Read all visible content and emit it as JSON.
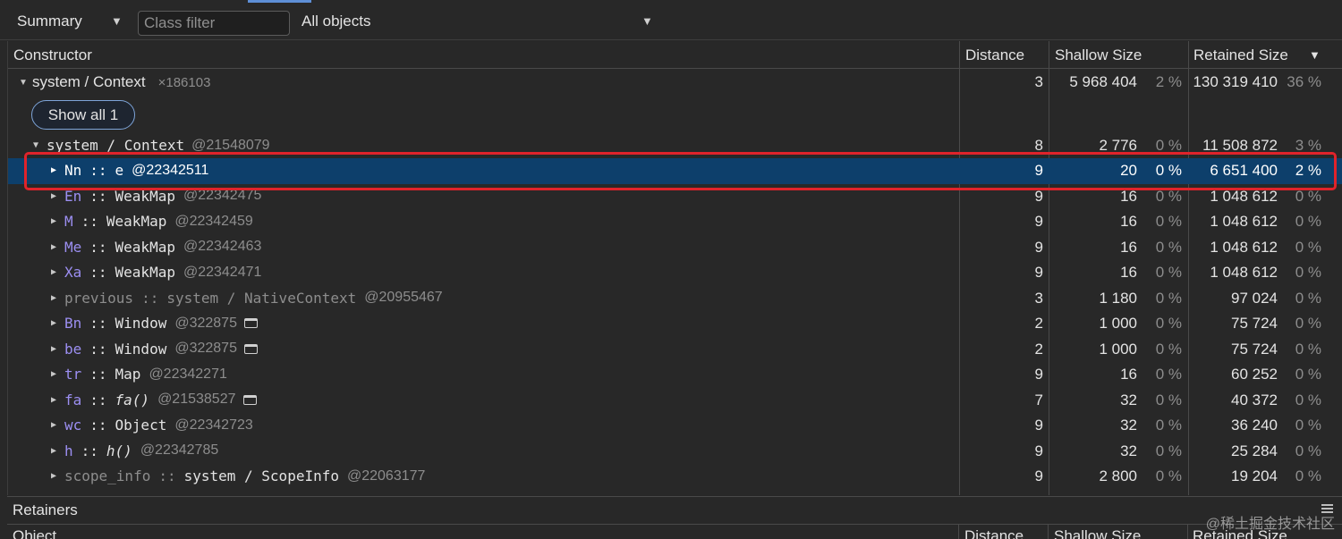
{
  "toolbar": {
    "view_select": "Summary",
    "class_filter_placeholder": "Class filter",
    "objects_select": "All objects"
  },
  "columns": {
    "constructor": "Constructor",
    "distance": "Distance",
    "shallow_size": "Shallow Size",
    "retained_size": "Retained Size"
  },
  "root": {
    "name": "system / Context",
    "count": "×186103",
    "distance": "3",
    "shallow": "5 968 404",
    "shallow_pct": "2 %",
    "retained": "130 319 410",
    "retained_pct": "36 %",
    "show_all_label": "Show all 1"
  },
  "context": {
    "name": "system / Context",
    "id": "@21548079",
    "distance": "8",
    "shallow": "2 776",
    "shallow_pct": "0 %",
    "retained": "11 508 872",
    "retained_pct": "3 %"
  },
  "rows": [
    {
      "prop": "Nn",
      "sep": "::",
      "cls": "e",
      "id": "@22342511",
      "distance": "9",
      "shallow": "20",
      "shallow_pct": "0 %",
      "retained": "6 651 400",
      "retained_pct": "2 %"
    },
    {
      "prop": "En",
      "sep": "::",
      "cls": "WeakMap",
      "id": "@22342475",
      "distance": "9",
      "shallow": "16",
      "shallow_pct": "0 %",
      "retained": "1 048 612",
      "retained_pct": "0 %"
    },
    {
      "prop": "M",
      "sep": "::",
      "cls": "WeakMap",
      "id": "@22342459",
      "distance": "9",
      "shallow": "16",
      "shallow_pct": "0 %",
      "retained": "1 048 612",
      "retained_pct": "0 %"
    },
    {
      "prop": "Me",
      "sep": "::",
      "cls": "WeakMap",
      "id": "@22342463",
      "distance": "9",
      "shallow": "16",
      "shallow_pct": "0 %",
      "retained": "1 048 612",
      "retained_pct": "0 %"
    },
    {
      "prop": "Xa",
      "sep": "::",
      "cls": "WeakMap",
      "id": "@22342471",
      "distance": "9",
      "shallow": "16",
      "shallow_pct": "0 %",
      "retained": "1 048 612",
      "retained_pct": "0 %"
    },
    {
      "prop": "previous",
      "sep": "::",
      "cls": "system / NativeContext",
      "id": "@20955467",
      "distance": "3",
      "shallow": "1 180",
      "shallow_pct": "0 %",
      "retained": "97 024",
      "retained_pct": "0 %"
    },
    {
      "prop": "Bn",
      "sep": "::",
      "cls": "Window",
      "id": "@322875",
      "distance": "2",
      "shallow": "1 000",
      "shallow_pct": "0 %",
      "retained": "75 724",
      "retained_pct": "0 %"
    },
    {
      "prop": "be",
      "sep": "::",
      "cls": "Window",
      "id": "@322875",
      "distance": "2",
      "shallow": "1 000",
      "shallow_pct": "0 %",
      "retained": "75 724",
      "retained_pct": "0 %"
    },
    {
      "prop": "tr",
      "sep": "::",
      "cls": "Map",
      "id": "@22342271",
      "distance": "9",
      "shallow": "16",
      "shallow_pct": "0 %",
      "retained": "60 252",
      "retained_pct": "0 %"
    },
    {
      "prop": "fa",
      "sep": "::",
      "cls": "fa()",
      "id": "@21538527",
      "distance": "7",
      "shallow": "32",
      "shallow_pct": "0 %",
      "retained": "40 372",
      "retained_pct": "0 %"
    },
    {
      "prop": "wc",
      "sep": "::",
      "cls": "Object",
      "id": "@22342723",
      "distance": "9",
      "shallow": "32",
      "shallow_pct": "0 %",
      "retained": "36 240",
      "retained_pct": "0 %"
    },
    {
      "prop": "h",
      "sep": "::",
      "cls": "h()",
      "id": "@22342785",
      "distance": "9",
      "shallow": "32",
      "shallow_pct": "0 %",
      "retained": "25 284",
      "retained_pct": "0 %"
    },
    {
      "prop": "scope_info",
      "sep": "::",
      "cls": "system / ScopeInfo",
      "id": "@22063177",
      "distance": "9",
      "shallow": "2 800",
      "shallow_pct": "0 %",
      "retained": "19 204",
      "retained_pct": "0 %"
    }
  ],
  "retainers": {
    "title": "Retainers",
    "col_object": "Object",
    "col_distance": "Distance",
    "col_shallow": "Shallow Size",
    "col_retained": "Retained Size"
  },
  "watermark": "@稀土掘金技术社区",
  "colors": {
    "background": "#282828",
    "selected_row": "#0d3f6b",
    "property_name": "#9c8ff2",
    "highlight_border": "#e0232b",
    "tab_accent": "#5e8fd6"
  }
}
